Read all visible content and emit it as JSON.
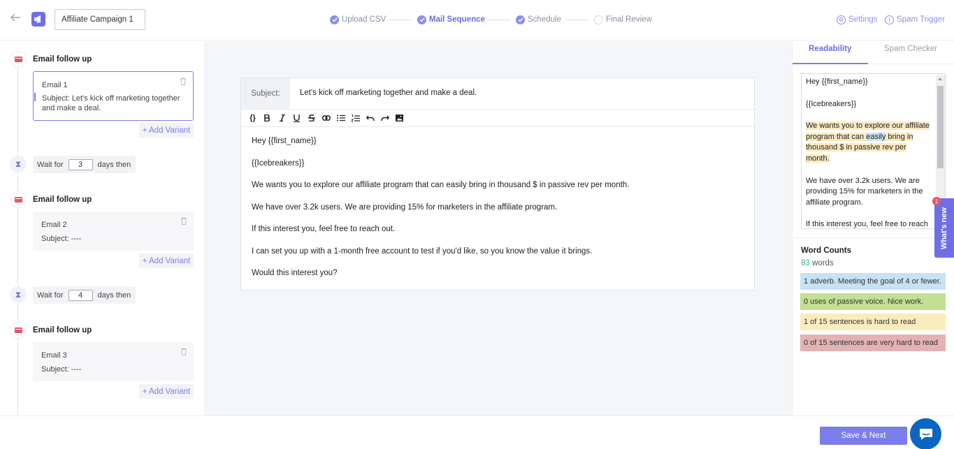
{
  "header": {
    "campaign_name": "Affiliate Campaign 1",
    "steps": [
      {
        "label": "Upload CSV",
        "state": "done"
      },
      {
        "label": "Mail Sequence",
        "state": "active"
      },
      {
        "label": "Schedule",
        "state": "done"
      },
      {
        "label": "Final Review",
        "state": "pending"
      }
    ],
    "settings_label": "Settings",
    "spam_trigger_label": "Spam Trigger"
  },
  "sequence": [
    {
      "title": "Email follow up",
      "email_name": "Email 1",
      "subject": "Subject: Let's kick off marketing together and make a deal.",
      "add_variant": "+ Add Variant"
    },
    {
      "wait_prefix": "Wait for",
      "wait_days": "3",
      "wait_suffix": "days then"
    },
    {
      "title": "Email follow up",
      "email_name": "Email 2",
      "subject": "Subject: ----",
      "add_variant": "+ Add Variant"
    },
    {
      "wait_prefix": "Wait for",
      "wait_days": "4",
      "wait_suffix": "days then"
    },
    {
      "title": "Email follow up",
      "email_name": "Email 3",
      "subject": "Subject: ----",
      "add_variant": "+ Add Variant"
    }
  ],
  "editor": {
    "subject_label": "Subject:",
    "subject_value": "Let's kick off marketing together and make a deal.",
    "toolbar_code": "{}",
    "body": [
      "Hey {{first_name}}",
      "{{Icebreakers}}",
      "We wants you to explore our affiliate program that can easily bring in thousand $ in passive rev per month.",
      "We have over 3.2k users. We are providing 15% for marketers in the affiliate program.",
      "If this interest you, feel free to reach out.",
      "I can set you up with a 1-month free account to test if you'd like, so you know the value it brings.",
      "Would this interest you?"
    ]
  },
  "right_panel": {
    "tabs": [
      "Readability",
      "Spam Checker"
    ],
    "preview": {
      "p1": "Hey {{first_name}}",
      "p2": "{{Icebreakers}}",
      "p3a": "We wants you to explore our affiliate program that can ",
      "p3adverb": "easily",
      "p3b": " bring in thousand $ in passive rev per month.",
      "p4": "We have over 3.2k users. We are providing 15% for marketers in the affiliate program.",
      "p5": "If this interest you, feel free to reach out."
    },
    "word_counts_title": "Word Counts",
    "word_count": "83",
    "words_label": "words",
    "stats": [
      {
        "text": "1 adverb. Meeting the goal of 4 or fewer.",
        "color": "#c7e2f3"
      },
      {
        "text": "0 uses of passive voice. Nice work.",
        "color": "#c4df93"
      },
      {
        "text": "1 of 15 sentences is hard to read",
        "color": "#faecbd"
      },
      {
        "text": "0 of 15 sentences are very hard to read",
        "color": "#e4b2b2"
      }
    ]
  },
  "whats_new": {
    "label": "What's new",
    "badge": "1"
  },
  "footer": {
    "save_label": "Save & Next"
  },
  "colors": {
    "accent": "#7b7eea",
    "mail_icon": "#e8546b",
    "chat": "#0a66c2"
  }
}
